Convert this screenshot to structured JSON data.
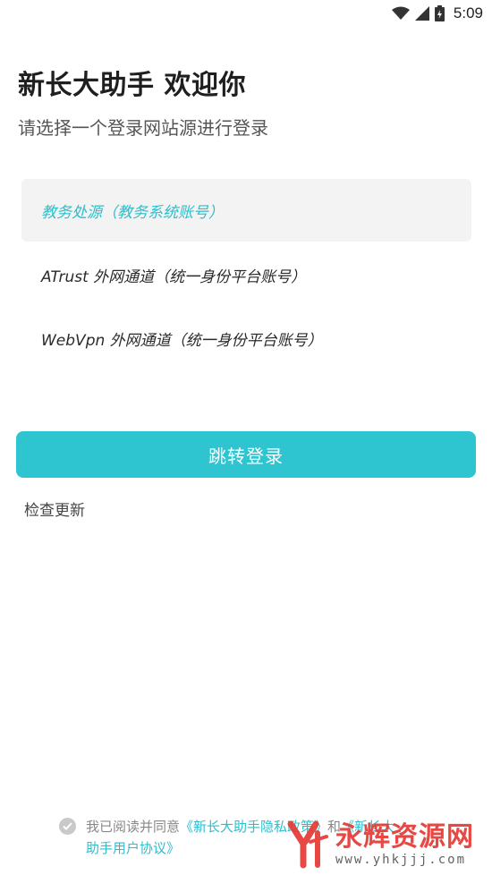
{
  "status_bar": {
    "time": "5:09",
    "icons": [
      "wifi-icon",
      "signal-icon",
      "battery-icon"
    ]
  },
  "header": {
    "title": "新长大助手 欢迎你",
    "subtitle": "请选择一个登录网站源进行登录"
  },
  "sources": [
    {
      "label": "教务处源（教务系统账号）",
      "selected": true
    },
    {
      "label": "ATrust 外网通道（统一身份平台账号）",
      "selected": false
    },
    {
      "label": "WebVpn 外网通道（统一身份平台账号）",
      "selected": false
    }
  ],
  "login_button": "跳转登录",
  "check_update": "检查更新",
  "agreement": {
    "prefix": "我已阅读并同意",
    "privacy_link": "《新长大助手隐私政策》",
    "conj": "和",
    "terms_link": "《新长大助手用户协议》"
  },
  "watermark": {
    "text": "永辉资源网",
    "url": "www.yhkjjj.com"
  },
  "colors": {
    "accent": "#2ec5d1",
    "selected_text": "#2bbfcd",
    "watermark": "#e53935"
  }
}
